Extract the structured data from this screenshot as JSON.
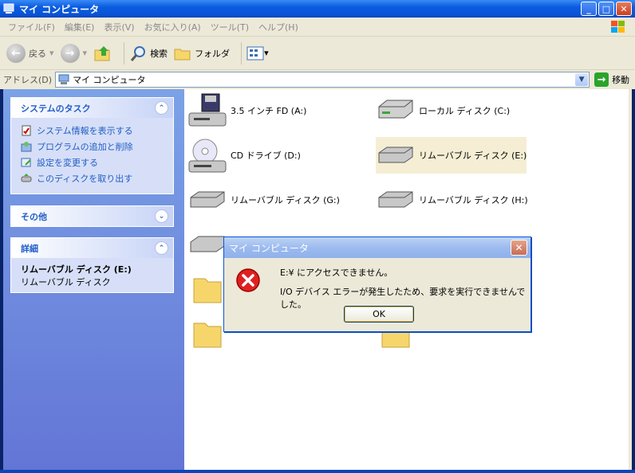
{
  "window": {
    "title": "マイ コンピュータ"
  },
  "menubar": {
    "items": [
      "ファイル(F)",
      "編集(E)",
      "表示(V)",
      "お気に入り(A)",
      "ツール(T)",
      "ヘルプ(H)"
    ]
  },
  "toolbar": {
    "back_label": "戻る",
    "search_label": "検索",
    "folder_label": "フォルダ"
  },
  "address": {
    "label": "アドレス(D)",
    "value": "マイ コンピュータ",
    "go_label": "移動"
  },
  "sidebar": {
    "system_tasks": {
      "title": "システムのタスク",
      "items": [
        "システム情報を表示する",
        "プログラムの追加と削除",
        "設定を変更する",
        "このディスクを取り出す"
      ]
    },
    "other": {
      "title": "その他"
    },
    "details": {
      "title": "詳細",
      "name": "リムーバブル ディスク (E:)",
      "type": "リムーバブル ディスク"
    }
  },
  "drives": [
    {
      "label": "3.5 インチ FD (A:)"
    },
    {
      "label": "ローカル ディスク (C:)"
    },
    {
      "label": "CD ドライブ (D:)"
    },
    {
      "label": "リムーバブル ディスク (E:)"
    },
    {
      "label": "リムーバブル ディスク (G:)"
    },
    {
      "label": "リムーバブル ディスク (H:)"
    }
  ],
  "dialog": {
    "title": "マイ コンピュータ",
    "message1": "E:¥ にアクセスできません。",
    "message2": "I/O デバイス エラーが発生したため、要求を実行できませんでした。",
    "ok_label": "OK"
  }
}
